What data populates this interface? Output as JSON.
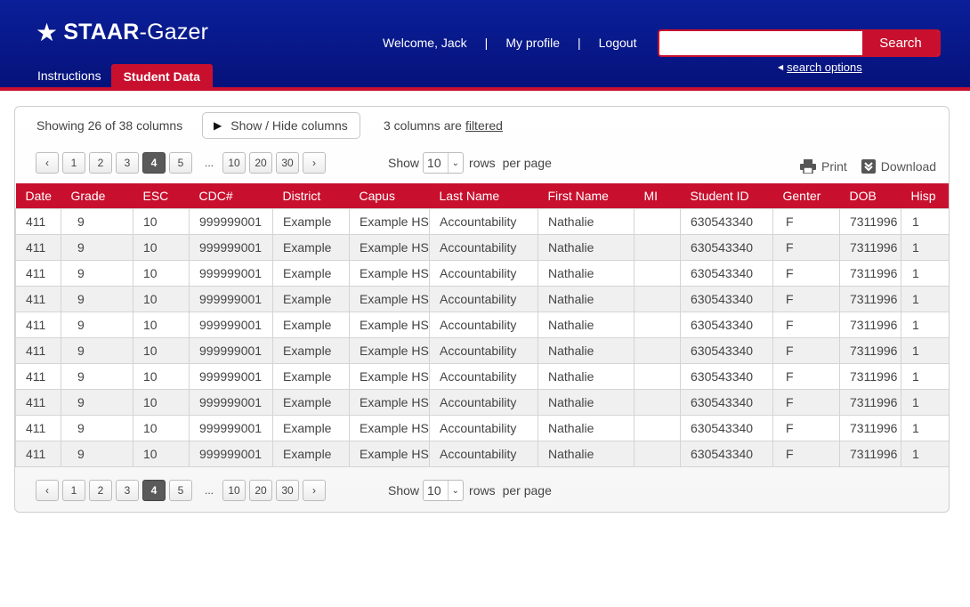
{
  "header": {
    "logo_star": "★",
    "logo_bold": "STAAR",
    "logo_rest": "-Gazer",
    "tabs": [
      {
        "label": "Instructions",
        "active": false
      },
      {
        "label": "Student Data",
        "active": true
      }
    ],
    "welcome": "Welcome, Jack",
    "separator": "|",
    "my_profile": "My profile",
    "logout": "Logout",
    "search": {
      "value": "",
      "placeholder": "",
      "button_label": "Search"
    },
    "search_options": "search options"
  },
  "toolbar": {
    "columns_info": "Showing 26 of 38 columns",
    "show_hide_label": "Show / Hide columns",
    "filter_text": "3 columns are",
    "filter_link": "filtered",
    "print_label": "Print",
    "download_label": "Download"
  },
  "pagination": {
    "prev": "‹",
    "next": "›",
    "pages": [
      "1",
      "2",
      "3",
      "4",
      "5"
    ],
    "ellipsis": "...",
    "jump_pages": [
      "10",
      "20",
      "30"
    ],
    "current_page": "4",
    "show_label": "Show",
    "rows_value": "10",
    "rows_label": "rows",
    "per_page_label": "per page"
  },
  "table": {
    "columns": [
      "Date",
      "Grade",
      "ESC",
      "CDC#",
      "District",
      "Capus",
      "Last Name",
      "First Name",
      "MI",
      "Student ID",
      "Genter",
      "DOB",
      "Hisp"
    ],
    "rows": [
      [
        "411",
        "9",
        "10",
        "999999001",
        "Example",
        "Example HS",
        "Accountability",
        "Nathalie",
        "",
        "630543340",
        "F",
        "7311996",
        "1"
      ],
      [
        "411",
        "9",
        "10",
        "999999001",
        "Example",
        "Example HS",
        "Accountability",
        "Nathalie",
        "",
        "630543340",
        "F",
        "7311996",
        "1"
      ],
      [
        "411",
        "9",
        "10",
        "999999001",
        "Example",
        "Example HS",
        "Accountability",
        "Nathalie",
        "",
        "630543340",
        "F",
        "7311996",
        "1"
      ],
      [
        "411",
        "9",
        "10",
        "999999001",
        "Example",
        "Example HS",
        "Accountability",
        "Nathalie",
        "",
        "630543340",
        "F",
        "7311996",
        "1"
      ],
      [
        "411",
        "9",
        "10",
        "999999001",
        "Example",
        "Example HS",
        "Accountability",
        "Nathalie",
        "",
        "630543340",
        "F",
        "7311996",
        "1"
      ],
      [
        "411",
        "9",
        "10",
        "999999001",
        "Example",
        "Example HS",
        "Accountability",
        "Nathalie",
        "",
        "630543340",
        "F",
        "7311996",
        "1"
      ],
      [
        "411",
        "9",
        "10",
        "999999001",
        "Example",
        "Example HS",
        "Accountability",
        "Nathalie",
        "",
        "630543340",
        "F",
        "7311996",
        "1"
      ],
      [
        "411",
        "9",
        "10",
        "999999001",
        "Example",
        "Example HS",
        "Accountability",
        "Nathalie",
        "",
        "630543340",
        "F",
        "7311996",
        "1"
      ],
      [
        "411",
        "9",
        "10",
        "999999001",
        "Example",
        "Example HS",
        "Accountability",
        "Nathalie",
        "",
        "630543340",
        "F",
        "7311996",
        "1"
      ],
      [
        "411",
        "9",
        "10",
        "999999001",
        "Example",
        "Example HS",
        "Accountability",
        "Nathalie",
        "",
        "630543340",
        "F",
        "7311996",
        "1"
      ]
    ]
  },
  "colors": {
    "header_blue": "#0a1f99",
    "accent_red": "#c8102e"
  }
}
